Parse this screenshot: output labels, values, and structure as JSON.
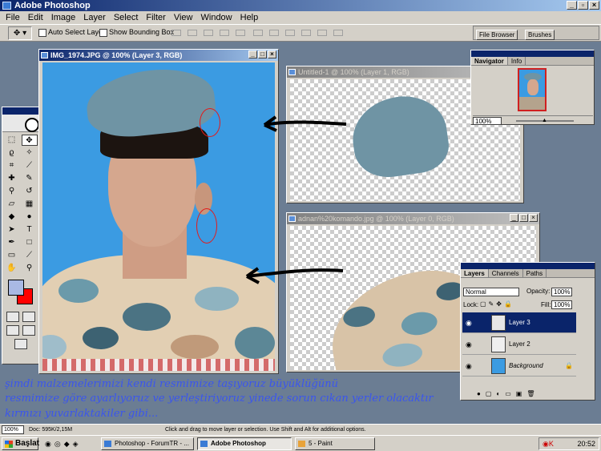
{
  "app": {
    "title": "Adobe Photoshop"
  },
  "menu": [
    "File",
    "Edit",
    "Image",
    "Layer",
    "Select",
    "Filter",
    "View",
    "Window",
    "Help"
  ],
  "options_bar": {
    "auto_select_label": "Auto Select Layer",
    "bounding_box_label": "Show Bounding Box"
  },
  "palette_well": {
    "tabs": [
      "File Browser",
      "Brushes"
    ]
  },
  "documents": {
    "main": {
      "title": "IMG_1974.JPG @ 100% (Layer 3, RGB)"
    },
    "untitled": {
      "title": "Untitled-1 @ 100% (Layer 1, RGB)"
    },
    "adnan": {
      "title": "adnan%20komando.jpg @ 100% (Layer 0, RGB)"
    }
  },
  "navigator": {
    "tabs": [
      "Navigator",
      "Info"
    ],
    "zoom": "100%"
  },
  "layers_panel": {
    "tabs": [
      "Layers",
      "Channels",
      "Paths"
    ],
    "blend_mode": "Normal",
    "opacity_label": "Opacity:",
    "opacity_value": "100%",
    "lock_label": "Lock:",
    "fill_label": "Fill:",
    "fill_value": "100%",
    "layers": [
      {
        "name": "Layer 3",
        "selected": true
      },
      {
        "name": "Layer 2",
        "selected": false
      },
      {
        "name": "Background",
        "selected": false
      }
    ]
  },
  "caption": [
    "şimdi  malzemelerimizi kendi resmimize taşıyoruz büyüklüğünü",
    "resmimize göre ayarlıyoruz ve yerleştiriyoruz yinede sorun cıkan yerler olacaktır",
    "kırmızı yuvarlaktakiler gibi..."
  ],
  "status_bar": {
    "zoom": "100%",
    "doc_size": "Doc: 595K/2,15M",
    "hint": "Click and drag to move layer or selection.  Use Shift and Alt for additional options."
  },
  "taskbar": {
    "start": "Başlat",
    "tasks": [
      "Photoshop - ForumTR - ...",
      "Adobe Photoshop",
      "5 - Paint"
    ],
    "time": "20:52"
  },
  "colors": {
    "foreground": "#a9b9e4",
    "background": "#ff0000",
    "caption": "#3a55ee",
    "title_active": "#0a246a"
  }
}
